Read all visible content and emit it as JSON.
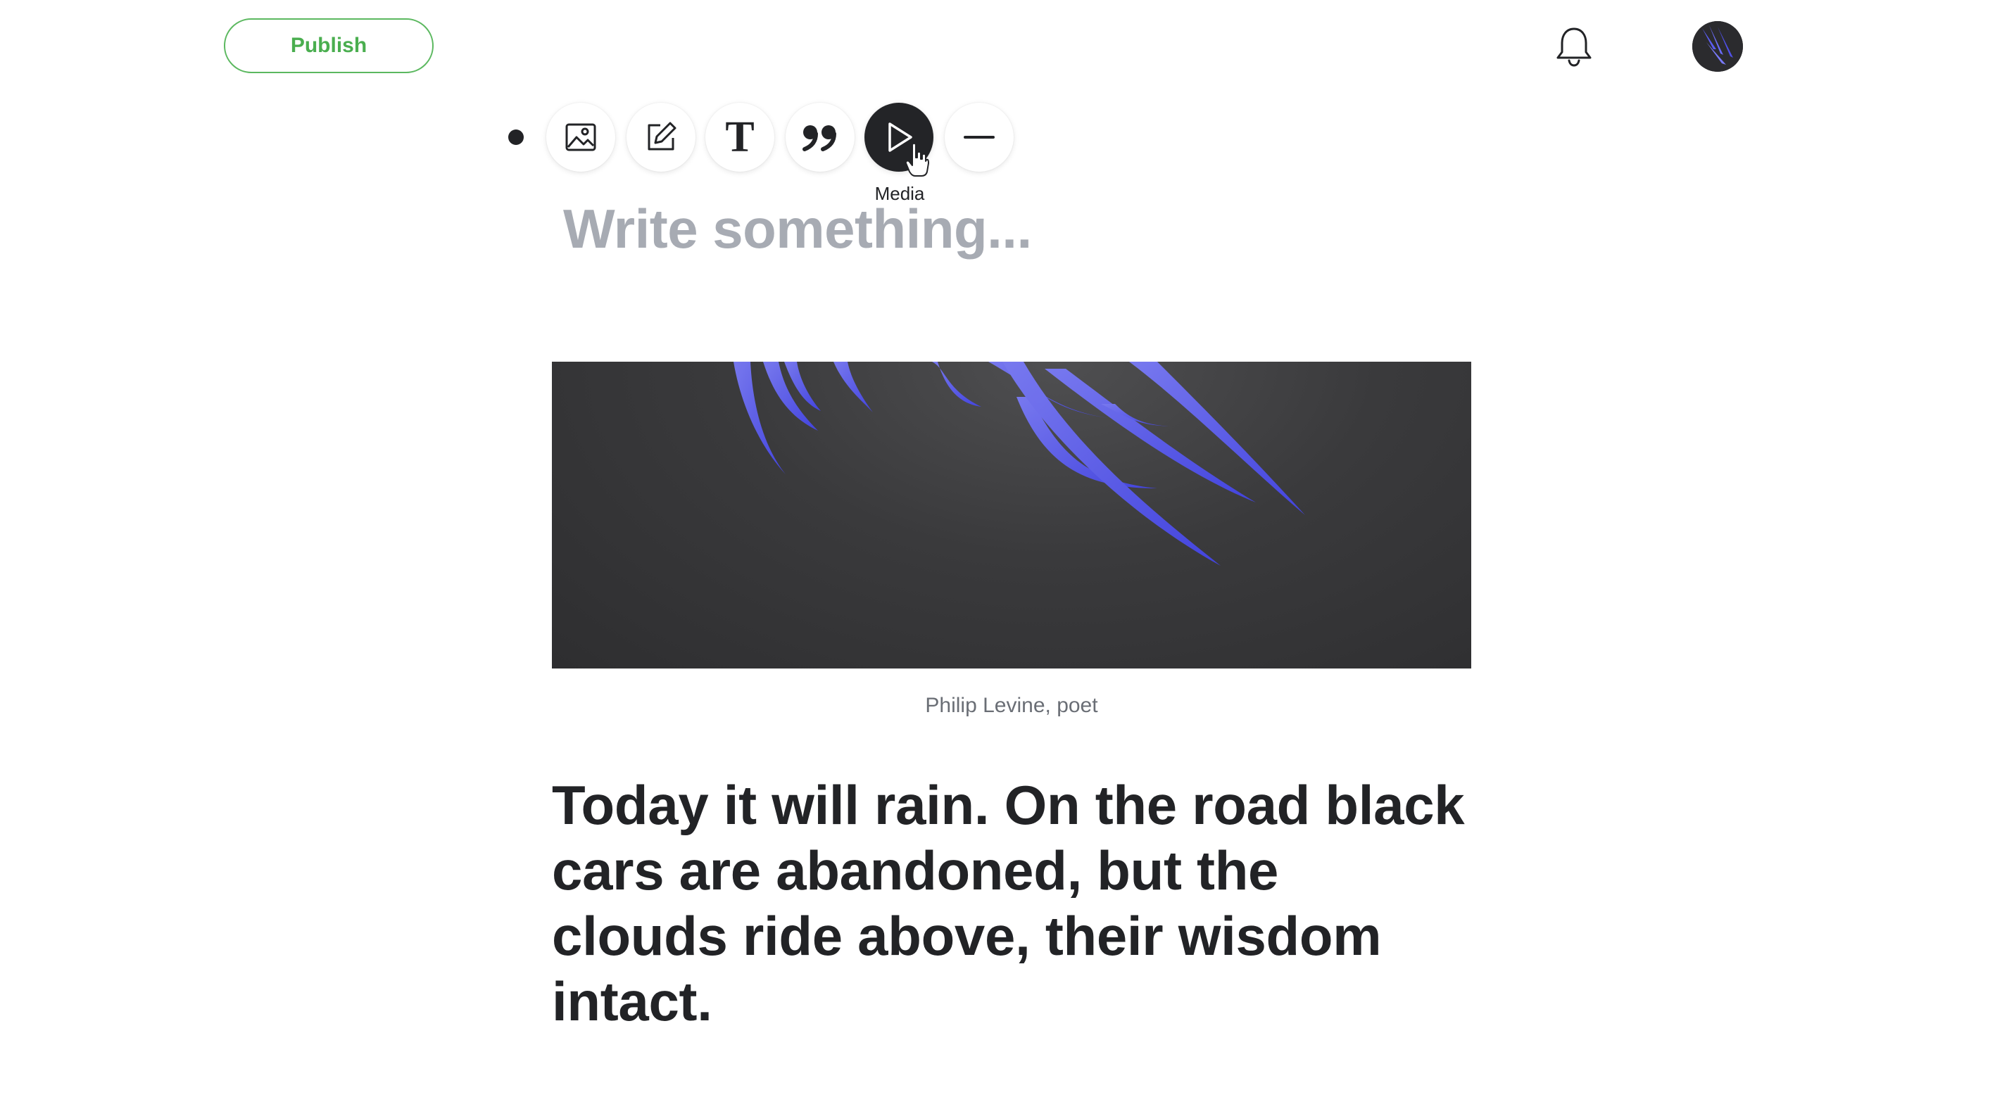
{
  "header": {
    "publish_label": "Publish",
    "notification_icon": "bell-icon",
    "avatar_icon": "user-avatar"
  },
  "toolbar": {
    "items": [
      {
        "icon": "image-icon"
      },
      {
        "icon": "edit-icon"
      },
      {
        "icon": "text-icon",
        "label": "T"
      },
      {
        "icon": "quote-icon"
      },
      {
        "icon": "play-icon",
        "active": true
      },
      {
        "icon": "divider-icon"
      }
    ],
    "tooltip": "Media"
  },
  "editor": {
    "placeholder": "Write something...",
    "image_caption": "Philip Levine, poet",
    "body": "Today it will rain. On the road black cars are abandoned, but the clouds ride above, their wisdom intact."
  },
  "colors": {
    "accent_green": "#4aae4f",
    "text_dark": "#222326",
    "placeholder_gray": "#a7abb3",
    "feather_blue": "#5b5cf0"
  }
}
